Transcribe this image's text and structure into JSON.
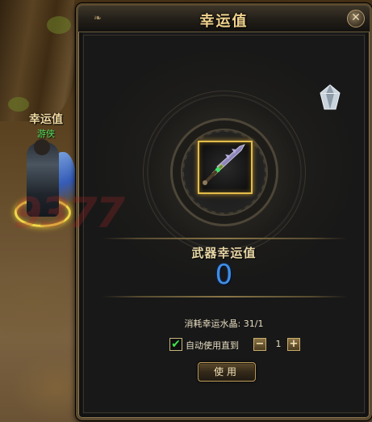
{
  "scene": {
    "npc_name": "幸运值",
    "npc_title": "游侠",
    "watermark": "9377"
  },
  "panel": {
    "title": "幸运值",
    "close_icon": "close-icon",
    "crystal_icon": "crystal-icon",
    "weapon_icon": "sword-icon"
  },
  "lucky": {
    "label": "武器幸运值",
    "value": "0"
  },
  "consume": {
    "text": "消耗幸运水晶: 31/1"
  },
  "auto_use": {
    "checked": true,
    "label": "自动使用直到",
    "minus": "−",
    "plus": "+",
    "count": "1"
  },
  "use_button": {
    "label": "使用"
  },
  "colors": {
    "accent_gold": "#e2bd4c",
    "value_blue": "#3f8fe6",
    "title_text": "#f2d48f"
  }
}
